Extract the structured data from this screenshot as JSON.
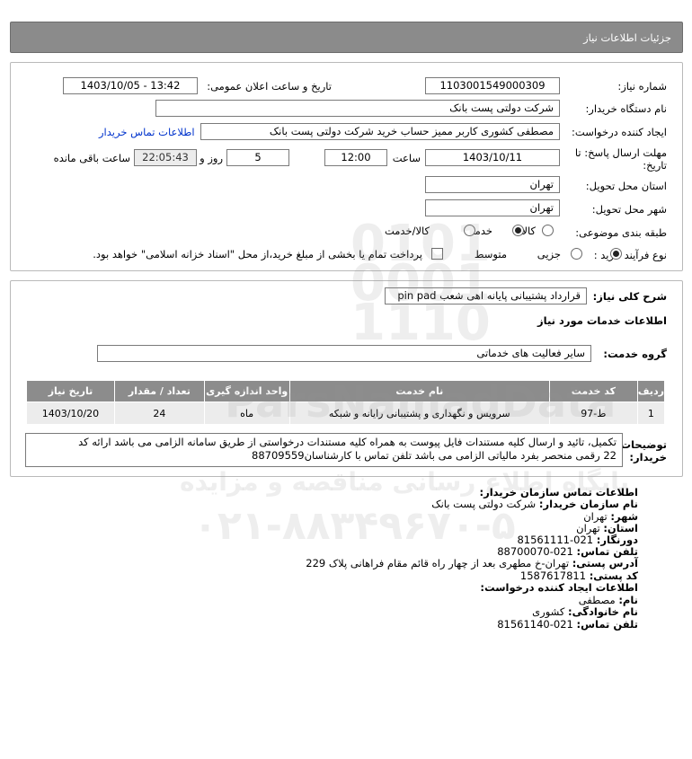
{
  "header": {
    "title": "جزئیات اطلاعات نیاز"
  },
  "form": {
    "need_number_label": "شماره نیاز:",
    "need_number": "1103001549000309",
    "announce_label": "تاریخ و ساعت اعلان عمومی:",
    "announce_value": "1403/10/05 - 13:42",
    "buyer_org_label": "نام دستگاه خریدار:",
    "buyer_org": "شرکت دولتی پست بانک",
    "requester_label": "ایجاد کننده درخواست:",
    "requester": "مصطفی کشوری کاربر ممیز حساب خرید شرکت دولتی پست بانک",
    "buyer_contact_link": "اطلاعات تماس خریدار",
    "deadline_label_1": "مهلت ارسال پاسخ: تا",
    "deadline_label_2": "تاریخ:",
    "deadline_date": "1403/10/11",
    "time_label": "ساعت",
    "deadline_time": "12:00",
    "days_value": "5",
    "days_label": "روز و",
    "remaining_time": "22:05:43",
    "remaining_label": "ساعت باقی مانده",
    "province_label": "استان محل تحویل:",
    "province": "تهران",
    "city_label": "شهر محل تحویل:",
    "city": "تهران",
    "category_label": "طبقه بندی موضوعی:",
    "category_options": [
      "کالا",
      "خدمت",
      "کالا/خدمت"
    ],
    "category_selected": "خدمت",
    "process_label": "نوع فرآیند خرید :",
    "process_options": [
      "جزیی",
      "متوسط"
    ],
    "process_selected": "جزیی",
    "payment_note": "پرداخت تمام یا بخشی از مبلغ خرید،از محل \"اسناد خزانه اسلامی\" خواهد بود."
  },
  "description": {
    "label": "شرح کلی نیاز:",
    "value": "قرارداد پشتیبانی پایانه اهی شعب pin pad",
    "services_title": "اطلاعات خدمات مورد نیاز",
    "service_group_label": "گروه خدمت:",
    "service_group": "سایر فعالیت های خدماتی"
  },
  "table": {
    "headers": [
      "ردیف",
      "کد خدمت",
      "نام خدمت",
      "واحد اندازه گیری",
      "تعداد / مقدار",
      "تاریخ نیاز"
    ],
    "rows": [
      [
        "1",
        "ط-97",
        "سرویس و نگهداری و پشتیبانی رایانه و شبکه",
        "ماه",
        "24",
        "1403/10/20"
      ]
    ]
  },
  "notes": {
    "label_1": "توضیحات",
    "label_2": "خریدار:",
    "line_1": "تکمیل، تائید و ارسال کلیه مستندات فایل پیوست به همراه کلیه مستندات درخواستی از طریق سامانه الزامی می باشد ارائه کد",
    "line_2": "22 رقمی منحصر بفرد مالیاتی الزامی می باشد تلفن تماس با کارشناسان88709559"
  },
  "contact": {
    "org_title": "اطلاعات تماس سازمان خریدار:",
    "org_name_label": "نام سازمان خریدار:",
    "org_name": "شرکت دولتی پست بانک",
    "city_label": "شهر:",
    "city": "تهران",
    "province_label": "استان:",
    "province": "تهران",
    "fax_label": "دورنگار:",
    "fax": "021-81561111",
    "phone_label": "تلفن تماس:",
    "phone": "021-88700070",
    "address_label": "آدرس پستی:",
    "address": "تهران-خ مطهری بعد از چهار راه قائم مقام فراهانی پلاک 229",
    "postal_label": "کد پستی:",
    "postal": "1587617811",
    "creator_title": "اطلاعات ایجاد کننده درخواست:",
    "first_name_label": "نام:",
    "first_name": "مصطفی",
    "last_name_label": "نام خانوادگی:",
    "last_name": "کشوری",
    "creator_phone_label": "تلفن تماس:",
    "creator_phone": "021-81561140"
  }
}
